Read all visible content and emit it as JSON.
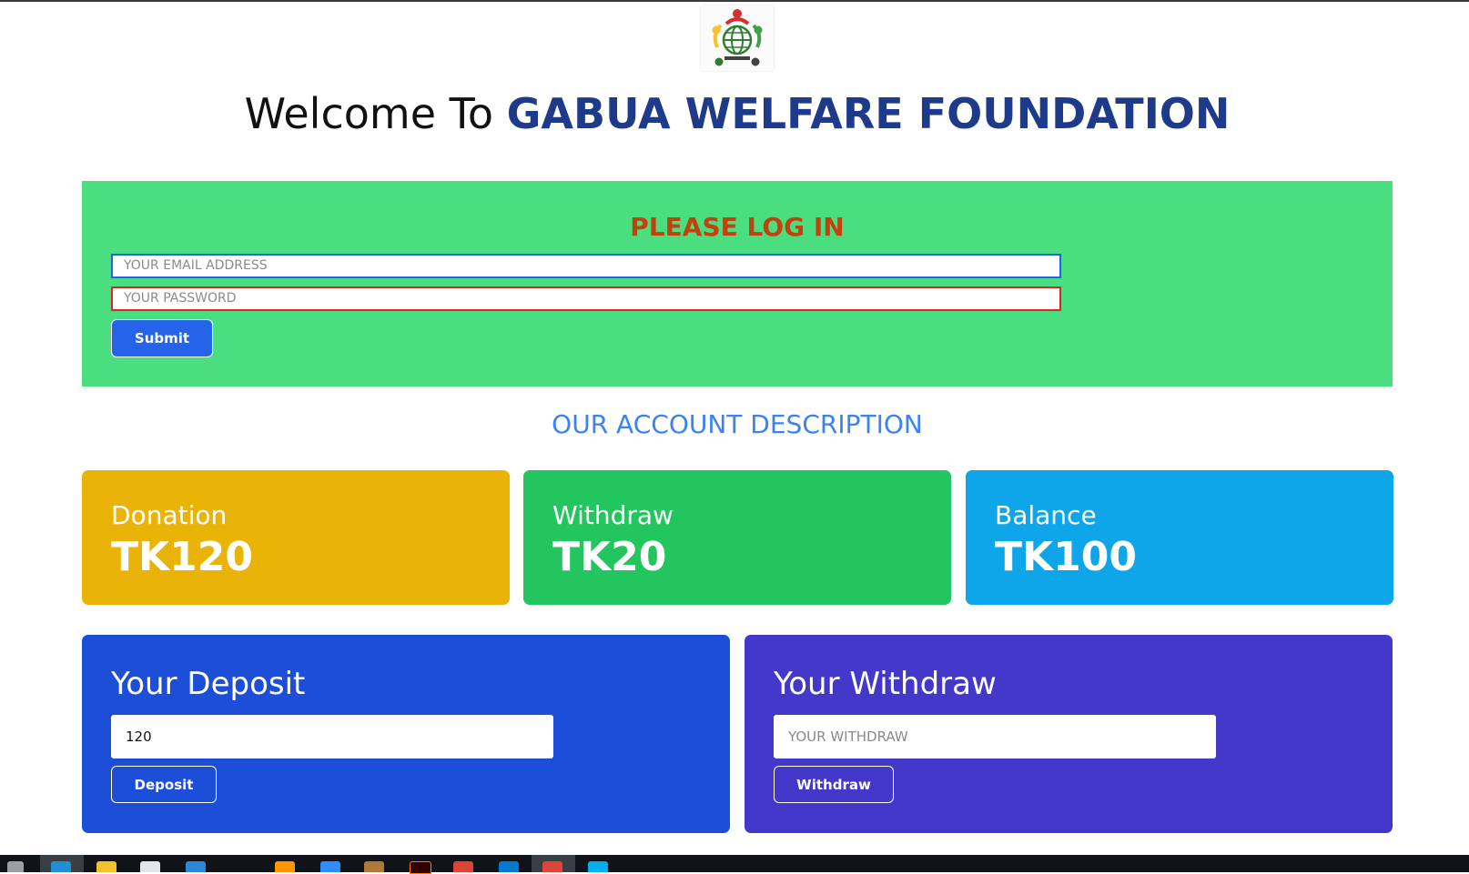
{
  "header": {
    "welcome_prefix": "Welcome To ",
    "brand": "GABUA WELFARE FOUNDATION"
  },
  "login": {
    "title": "PLEASE LOG IN",
    "email_placeholder": "YOUR EMAIL ADDRESS",
    "password_placeholder": "YOUR PASSWORD",
    "submit_label": "Submit"
  },
  "account": {
    "section_title": "OUR ACCOUNT DESCRIPTION",
    "stats": [
      {
        "label": "Donation",
        "value": "TK120",
        "color": "#eab308"
      },
      {
        "label": "Withdraw",
        "value": "TK20",
        "color": "#22c55e"
      },
      {
        "label": "Balance",
        "value": "TK100",
        "color": "#0ea5e9"
      }
    ]
  },
  "deposit": {
    "title": "Your Deposit",
    "input_value": "120",
    "button_label": "Deposit"
  },
  "withdraw": {
    "title": "Your Withdraw",
    "input_placeholder": "YOUR WITHDRAW",
    "button_label": "Withdraw"
  },
  "taskbar": {
    "icons": [
      "start-icon",
      "edge-icon",
      "file-explorer-icon",
      "store-icon",
      "mail-icon",
      "firefox-icon",
      "zoom-icon",
      "app-icon",
      "illustrator-icon",
      "chrome-icon",
      "vscode-icon",
      "chrome-icon",
      "skype-icon"
    ]
  }
}
